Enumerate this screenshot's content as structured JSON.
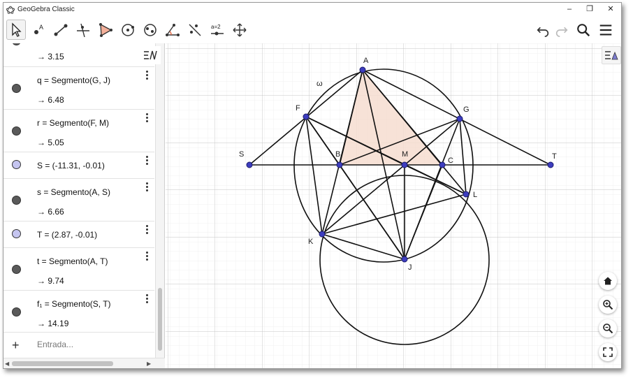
{
  "window": {
    "title": "GeoGebra Classic",
    "controls": [
      "–",
      "❐",
      "✕"
    ]
  },
  "toolbar": {
    "tools": [
      {
        "name": "move-tool-icon",
        "selected": true
      },
      {
        "name": "point-tool-icon"
      },
      {
        "name": "segment-tool-icon"
      },
      {
        "name": "perpendicular-line-tool-icon"
      },
      {
        "name": "polygon-tool-icon"
      },
      {
        "name": "circle-tool-icon"
      },
      {
        "name": "ellipse-tool-icon"
      },
      {
        "name": "angle-tool-icon"
      },
      {
        "name": "reflect-tool-icon"
      },
      {
        "name": "slider-tool-icon",
        "label": "a=2"
      },
      {
        "name": "move-graphics-tool-icon"
      }
    ],
    "right": [
      "undo-icon",
      "redo-icon",
      "search-icon",
      "menu-icon"
    ]
  },
  "algebra": {
    "rows": [
      {
        "definition": "",
        "value": "→  3.15",
        "marker_color": "#5a5a5a"
      },
      {
        "definition": "q  =  Segmento(G, J)",
        "value": "→  6.48",
        "marker_color": "#5a5a5a"
      },
      {
        "definition": "r  =  Segmento(F, M)",
        "value": "→  5.05",
        "marker_color": "#5a5a5a"
      },
      {
        "definition": "S  =  (-11.31, -0.01)",
        "value": "",
        "marker_color": "#c5c5f0"
      },
      {
        "definition": "s  =  Segmento(A, S)",
        "value": "→  6.66",
        "marker_color": "#5a5a5a"
      },
      {
        "definition": "T  =  (2.87, -0.01)",
        "value": "",
        "marker_color": "#c5c5f0"
      },
      {
        "definition": "t  =  Segmento(A, T)",
        "value": "→  9.74",
        "marker_color": "#5a5a5a"
      },
      {
        "definition": "f₁  =  Segmento(S, T)",
        "value": "→  14.19",
        "marker_color": "#5a5a5a"
      }
    ],
    "input_placeholder": "Entrada...",
    "plus": "+"
  },
  "graphics": {
    "labels": {
      "A": "A",
      "B": "B",
      "C": "C",
      "F": "F",
      "G": "G",
      "J": "J",
      "K": "K",
      "L": "L",
      "M": "M",
      "S": "S",
      "T": "T",
      "omega": "ω"
    },
    "point_color": "#3d3dbf",
    "triangle_fill": "#f6ddd0"
  }
}
